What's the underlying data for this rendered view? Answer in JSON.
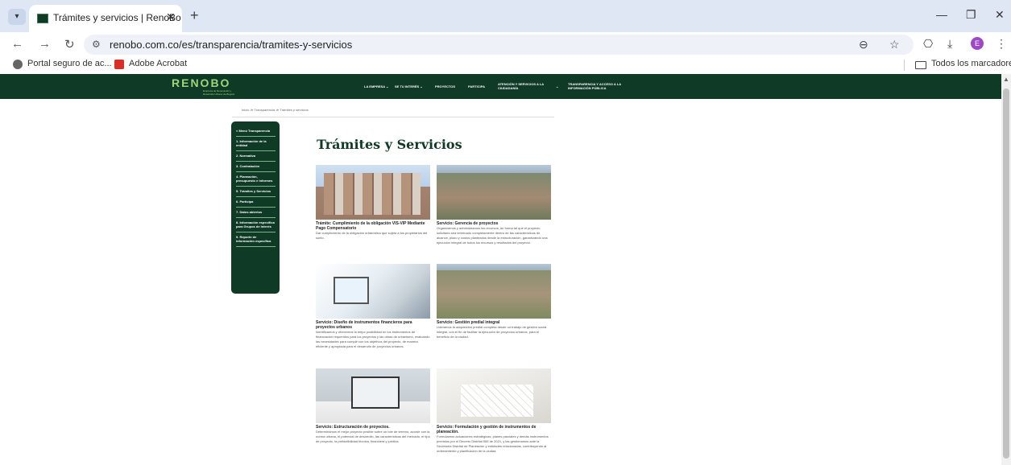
{
  "browser": {
    "tab_title": "Trámites y servicios | RenoBo",
    "url": "renobo.com.co/es/transparencia/tramites-y-servicios",
    "bookmarks": [
      "Portal seguro de ac...",
      "Adobe Acrobat"
    ],
    "all_bookmarks": "Todos los marcadores",
    "profile_initial": "E",
    "icons": {
      "tab_menu": "▾",
      "close": "✕",
      "new_tab": "+",
      "minimize": "—",
      "restore": "❐",
      "window_close": "✕",
      "back": "←",
      "forward": "→",
      "reload": "↻",
      "site_info": "⚙",
      "zoom": "⊖",
      "star": "☆",
      "extensions": "⎔",
      "download": "⤓",
      "menu": "⋮",
      "scroll_up": "▲"
    }
  },
  "site": {
    "logo": "RENOBO",
    "logo_subtitle": "Empresa de Renovación y Desarrollo Urbano de Bogotá",
    "menu": [
      "LA EMPRESA ⌄",
      "SE TU INTERÉS ⌄",
      "PROYECTOS",
      "PARTICIPA",
      "ATENCIÓN Y SERVICIOS A LA CIUDADANÍA",
      "⌄",
      "TRANSPARENCIA Y ACCESO A LA INFORMACIÓN PÚBLICA"
    ],
    "breadcrumb": "Inicio  ≫  Transparencia  ≫  Trámites y servicios",
    "sidenav": [
      "< Menú Transparencia",
      "1. Información de la entidad",
      "2. Normativa",
      "3. Contratación",
      "4. Planeación, presupuesto e informes",
      "5. Trámites y Servicios",
      "6. Participa",
      "7. Datos abiertos",
      "8. Información específica para Grupos de Interés",
      "9. Reporte de información específica"
    ],
    "page_title": "Trámites y Servicios",
    "cards": [
      {
        "title": "Trámite: Cumplimiento de la obligación VIS-VIP Mediante Pago Compensatorio",
        "text": "Dar cumplimiento de la obligación urbanística que sujeta a los propietarios del suelo."
      },
      {
        "title": "Servicio: Gerencia de proyectos",
        "text": "Organizamos y administramos los recursos, de forma tal que el proyecto solicitado sea terminado completamente dentro de las características de alcance, plazo y costos planteados desde la estructuración, garantizando una ejecución integral de todos los recursos y resultados del proyecto."
      },
      {
        "title": "Servicio: Diseño de instrumentos financieros para proyectos urbanos",
        "text": "Identificamos y ofrecemos la mejor posibilidad en los instrumentos de financiación requeridos para los proyectos y las obras de urbanismo, evaluando las necesidades para cumplir con los objetivos del proyecto, de manera eficiente y apropiada para el desarrollo de proyectos urbanos."
      },
      {
        "title": "Servicio: Gestión predial integral",
        "text": "Lideramos la adquisición predial completa desde un trabajo de gestión social integral, con el fin de facilitar la ejecución de proyectos urbanos, para el beneficio de la ciudad."
      },
      {
        "title": "Servicio: Estructuración de proyectos.",
        "text": "Determinamos el mejor proyecto posible sobre un lote de terreno, acorde con la norma urbana, el potencial de desarrollo, las características del mercado, el tipo de proyecto, la prefactibilidad técnica, financiera y jurídica."
      },
      {
        "title": "Servicio: Formulación y gestión de instrumentos de planeación.",
        "text": "Formulamos actuaciones estratégicas, planes parciales y demás instrumentos previstos por el Decreto Distrital 555 de 2021, y las gestionamos ante la Secretaría Distrital de Planeación y entidades relacionadas, contribuyendo al ordenamiento y planificación de la ciudad."
      }
    ]
  },
  "colors": {
    "header_green": "#0f3a26",
    "logo_green": "#9fd47a",
    "title_green": "#0f3a26",
    "sidenav_divider": "#7ab387"
  }
}
